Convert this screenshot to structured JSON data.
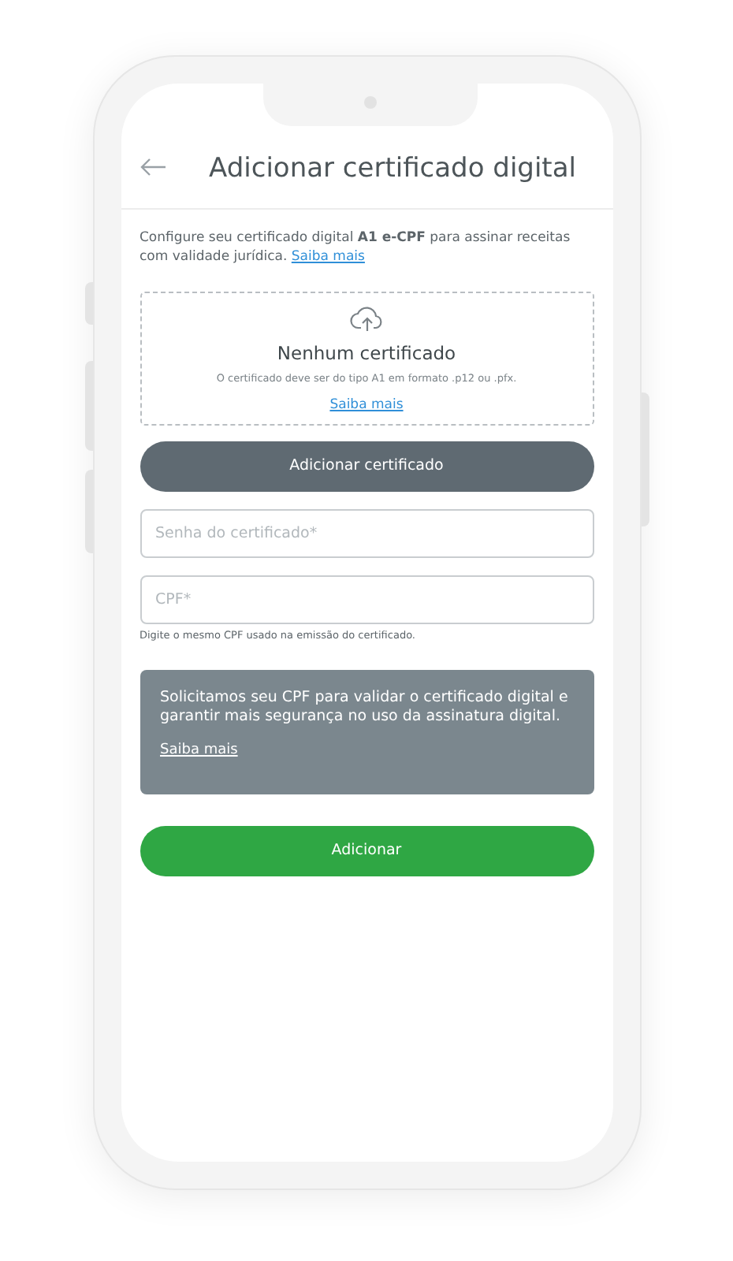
{
  "header": {
    "title": "Adicionar certificado digital"
  },
  "intro": {
    "text": "Configure seu certificado digital **A1 e-CPF** para assinar receitas com validade jurídica.",
    "link": "Saiba mais"
  },
  "upload": {
    "title": "Nenhum certificado",
    "hint": "O certificado deve ser do tipo A1 em formato .p12 ou .pfx.",
    "link": "Saiba mais"
  },
  "add_certificate_button": "Adicionar certificado",
  "fields": [
    {
      "placeholder": "Senha do certificado*"
    },
    {
      "placeholder": "CPF*",
      "helper": "Digite o mesmo CPF usado na emissão do certificado."
    }
  ],
  "info": {
    "text": "Solicitamos seu CPF para validar o certificado digital e garantir mais segurança no uso da assinatura digital.",
    "link": "Saiba mais"
  },
  "submit_button": "Adicionar"
}
